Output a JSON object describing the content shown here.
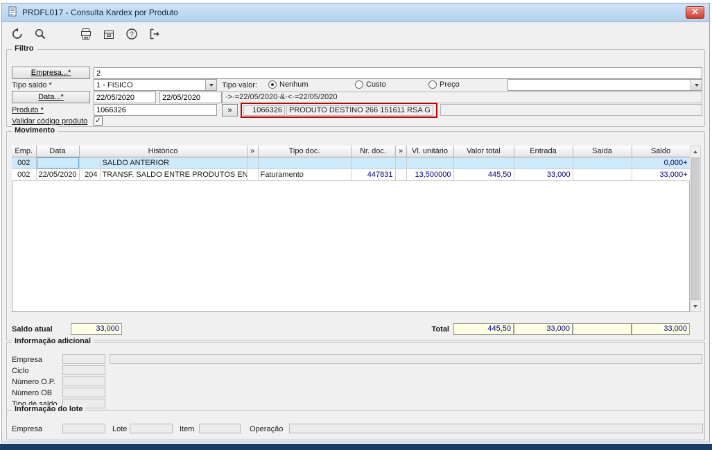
{
  "window": {
    "title": "PRDFL017 - Consulta Kardex por Produto"
  },
  "filtro": {
    "legend": "Filtro",
    "empresa_button": "Empresa...*",
    "empresa_value": "2",
    "tipo_saldo_label": "Tipo saldo *",
    "tipo_saldo_value": "1 - FISICO",
    "tipo_valor_label": "Tipo valor:",
    "radio_nenhum": "Nenhum",
    "radio_custo": "Custo",
    "radio_preco": "Preço",
    "combo_direito_value": "",
    "data_button": "Data...*",
    "data_inicial": "22/05/2020",
    "data_final": "22/05/2020",
    "data_expressao": "·>·=22/05/2020·&·<·=22/05/2020",
    "produto_label": "Produto *",
    "produto_value": "1066326",
    "lookup_label": "»",
    "produto_codigo": "1066326",
    "produto_descricao": "PRODUTO DESTINO 266 151611 RSA G",
    "validar_label": "Validar código produto",
    "validar_glyph": "✓"
  },
  "movimento": {
    "legend": "Movimento",
    "columns": {
      "emp": "Emp.",
      "data": "Data",
      "historico": "Histórico",
      "chev1": "»",
      "tipo_doc": "Tipo doc.",
      "nr_doc": "Nr. doc.",
      "chev2": "»",
      "vl_unitario": "Vl. unitário",
      "valor_total": "Valor total",
      "entrada": "Entrada",
      "saida": "Saída",
      "saldo": "Saldo"
    },
    "rows": [
      {
        "emp": "002",
        "data": "",
        "hist_cod": "",
        "historico": "SALDO ANTERIOR",
        "tipo_doc": "",
        "nr_doc": "",
        "vl_unitario": "",
        "valor_total": "",
        "entrada": "",
        "saida": "",
        "saldo": "0,000+"
      },
      {
        "emp": "002",
        "data": "22/05/2020",
        "hist_cod": "204",
        "historico": "TRANSF. SALDO ENTRE PRODUTOS ENTRADA",
        "tipo_doc": "Faturamento",
        "nr_doc": "447831",
        "vl_unitario": "13,500000",
        "valor_total": "445,50",
        "entrada": "33,000",
        "saida": "",
        "saldo": "33,000+"
      }
    ],
    "saldo_atual_label": "Saldo atual",
    "saldo_atual_value": "33,000",
    "total_label": "Total",
    "total_valor_total": "445,50",
    "total_entrada": "33,000",
    "total_saida": "",
    "total_saldo": "33,000"
  },
  "info_adicional": {
    "legend": "Informação adicional",
    "empresa_label": "Empresa",
    "ciclo_label": "Ciclo",
    "numero_op_label": "Número O.P.",
    "numero_ob_label": "Número OB",
    "tipo_saldo_label": "Tipo de saldo"
  },
  "info_lote": {
    "legend": "Informação do lote",
    "empresa_label": "Empresa",
    "lote_label": "Lote",
    "item_label": "Item",
    "operacao_label": "Operação"
  },
  "colors": {
    "titlebar": "#bcd7f2",
    "selected_row": "#cdeafc",
    "total_field_bg": "#ffffe1",
    "highlight_border": "#c00000",
    "numeric_text": "#00008b",
    "taskbar_strip": "#1b3c63"
  }
}
